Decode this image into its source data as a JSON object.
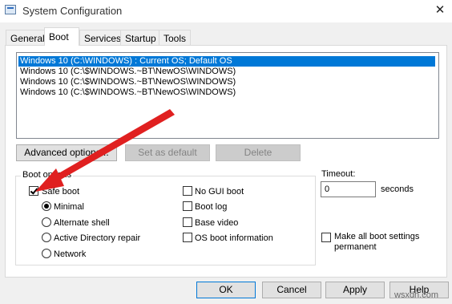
{
  "window": {
    "title": "System Configuration",
    "close_glyph": "✕"
  },
  "tabs": [
    {
      "label": "General"
    },
    {
      "label": "Boot"
    },
    {
      "label": "Services"
    },
    {
      "label": "Startup"
    },
    {
      "label": "Tools"
    }
  ],
  "active_tab": "Boot",
  "os_list": [
    {
      "label": "Windows 10 (C:\\WINDOWS) : Current OS; Default OS",
      "selected": true
    },
    {
      "label": "Windows 10 (C:\\$WINDOWS.~BT\\NewOS\\WINDOWS)",
      "selected": false
    },
    {
      "label": "Windows 10 (C:\\$WINDOWS.~BT\\NewOS\\WINDOWS)",
      "selected": false
    },
    {
      "label": "Windows 10 (C:\\$WINDOWS.~BT\\NewOS\\WINDOWS)",
      "selected": false
    }
  ],
  "list_buttons": {
    "advanced": "Advanced options...",
    "set_default": "Set as default",
    "delete": "Delete"
  },
  "boot_options": {
    "legend": "Boot options",
    "safe_boot": {
      "label": "Safe boot",
      "checked": true
    },
    "safe_boot_modes": [
      {
        "label": "Minimal",
        "selected": true
      },
      {
        "label": "Alternate shell",
        "selected": false
      },
      {
        "label": "Active Directory repair",
        "selected": false
      },
      {
        "label": "Network",
        "selected": false
      }
    ],
    "no_gui_boot": {
      "label": "No GUI boot",
      "checked": false
    },
    "boot_log": {
      "label": "Boot log",
      "checked": false
    },
    "base_video": {
      "label": "Base video",
      "checked": false
    },
    "os_boot_information": {
      "label": "OS boot information",
      "checked": false
    }
  },
  "timeout": {
    "label": "Timeout:",
    "value": "0",
    "unit": "seconds"
  },
  "make_permanent": {
    "label_line1": "Make all boot settings",
    "label_line2": "permanent",
    "checked": false
  },
  "dialog_buttons": {
    "ok": "OK",
    "cancel": "Cancel",
    "apply": "Apply",
    "help": "Help"
  },
  "watermark": "wsxdn.com",
  "colors": {
    "selection": "#0078d7",
    "arrow": "#e02020",
    "primary_border": "#0078d7"
  }
}
